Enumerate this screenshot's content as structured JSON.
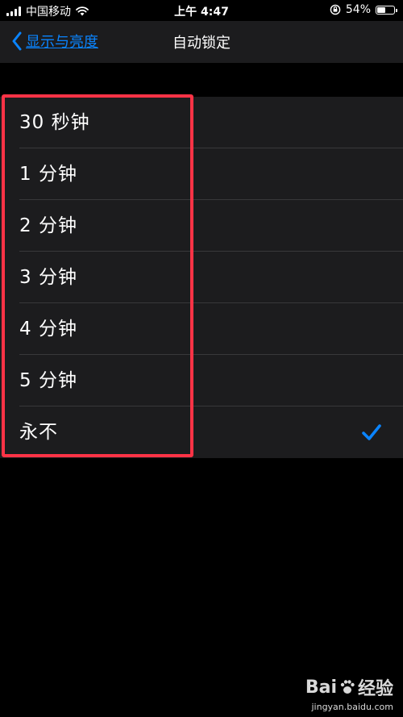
{
  "status_bar": {
    "carrier": "中国移动",
    "time": "上午 4:47",
    "battery_percent": "54%",
    "battery_level": 0.54
  },
  "nav": {
    "back_label": "显示与亮度",
    "title": "自动锁定"
  },
  "options": [
    {
      "label": "30 秒钟",
      "selected": false
    },
    {
      "label": "1 分钟",
      "selected": false
    },
    {
      "label": "2 分钟",
      "selected": false
    },
    {
      "label": "3 分钟",
      "selected": false
    },
    {
      "label": "4 分钟",
      "selected": false
    },
    {
      "label": "5 分钟",
      "selected": false
    },
    {
      "label": "永不",
      "selected": true
    }
  ],
  "watermark": {
    "brand_left": "Bai",
    "brand_right": "经验",
    "url": "jingyan.baidu.com"
  },
  "colors": {
    "accent": "#0a84ff",
    "highlight": "#ff3346",
    "cell_background": "#1c1c1e"
  },
  "icons": {
    "back": "chevron-left-icon",
    "wifi": "wifi-icon",
    "orientation_lock": "orientation-lock-icon",
    "battery": "battery-icon",
    "selected": "checkmark-icon",
    "watermark": "baidu-paw-icon"
  }
}
